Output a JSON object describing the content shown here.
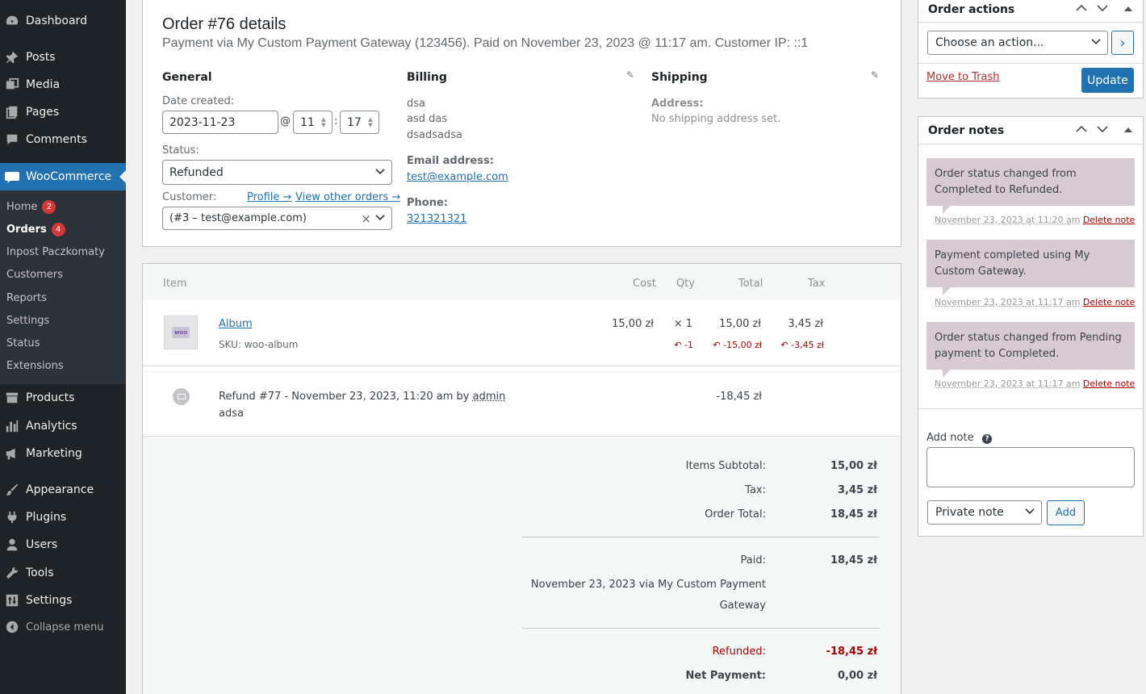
{
  "sidebar": {
    "items": [
      {
        "label": "Dashboard"
      },
      {
        "label": "Posts"
      },
      {
        "label": "Media"
      },
      {
        "label": "Pages"
      },
      {
        "label": "Comments"
      },
      {
        "label": "WooCommerce"
      },
      {
        "label": "Products"
      },
      {
        "label": "Analytics"
      },
      {
        "label": "Marketing"
      },
      {
        "label": "Appearance"
      },
      {
        "label": "Plugins"
      },
      {
        "label": "Users"
      },
      {
        "label": "Tools"
      },
      {
        "label": "Settings"
      }
    ],
    "woo_submenu": [
      {
        "label": "Home",
        "badge": "2"
      },
      {
        "label": "Orders",
        "badge": "4"
      },
      {
        "label": "Inpost Paczkomaty"
      },
      {
        "label": "Customers"
      },
      {
        "label": "Reports"
      },
      {
        "label": "Settings"
      },
      {
        "label": "Status"
      },
      {
        "label": "Extensions"
      }
    ],
    "collapse_label": "Collapse menu"
  },
  "order": {
    "title": "Order #76 details",
    "subtitle": "Payment via My Custom Payment Gateway (123456). Paid on November 23, 2023 @ 11:17 am. Customer IP: ::1",
    "general": {
      "title": "General",
      "date_label": "Date created:",
      "date_value": "2023-11-23",
      "at": "@",
      "hour": "11",
      "colon": ":",
      "minute": "17",
      "status_label": "Status:",
      "status_value": "Refunded",
      "customer_label": "Customer:",
      "profile_link": "Profile →",
      "other_orders_link": "View other orders →",
      "customer_value": "(#3 – test@example.com)",
      "clear": "×"
    },
    "billing": {
      "title": "Billing",
      "address_lines": [
        "dsa",
        "asd das",
        "dsadsadsa"
      ],
      "email_label": "Email address:",
      "email": "test@example.com",
      "phone_label": "Phone:",
      "phone": "321321321"
    },
    "shipping": {
      "title": "Shipping",
      "address_label": "Address:",
      "address_value": "No shipping address set."
    }
  },
  "items": {
    "headers": {
      "item": "Item",
      "cost": "Cost",
      "qty": "Qty",
      "total": "Total",
      "tax": "Tax"
    },
    "rows": [
      {
        "name": "Album",
        "sku": "SKU: woo-album",
        "thumb": "woo",
        "cost": "15,00 zł",
        "qty": "× 1",
        "total": "15,00 zł",
        "tax": "3,45 zł",
        "refund_qty": "↶ -1",
        "refund_total": "↶ -15,00 zł",
        "refund_tax": "↶ -3,45 zł"
      }
    ],
    "refund": {
      "text": "Refund #77 - November 23, 2023, 11:20 am by",
      "by": "admin",
      "reason": "adsa",
      "amount": "-18,45 zł"
    }
  },
  "totals": {
    "items_subtotal_label": "Items Subtotal:",
    "items_subtotal": "15,00 zł",
    "tax_label": "Tax:",
    "tax": "3,45 zł",
    "order_total_label": "Order Total:",
    "order_total": "18,45 zł",
    "paid_label": "Paid:",
    "paid": "18,45 zł",
    "paid_via_line1": "November 23, 2023 via My Custom Payment",
    "paid_via_line2": "Gateway",
    "refunded_label": "Refunded:",
    "refunded": "-18,45 zł",
    "net_label": "Net Payment:",
    "net": "0,00 zł"
  },
  "order_actions": {
    "title": "Order actions",
    "select_value": "Choose an action...",
    "go": "›",
    "trash": "Move to Trash",
    "update": "Update"
  },
  "order_notes": {
    "title": "Order notes",
    "notes": [
      {
        "text": "Order status changed from Completed to Refunded.",
        "meta": "November 23, 2023 at 11:20 am",
        "delete": "Delete note"
      },
      {
        "text": "Payment completed using My Custom Gateway.",
        "meta": "November 23, 2023 at 11:17 am",
        "delete": "Delete note"
      },
      {
        "text": "Order status changed from Pending payment to Completed.",
        "meta": "November 23, 2023 at 11:17 am",
        "delete": "Delete note"
      }
    ],
    "add_note_label": "Add note",
    "help": "?",
    "note_type": "Private note",
    "add_button": "Add"
  },
  "colors": {
    "sidebar_bg": "#1d2327",
    "accent": "#2271b1",
    "note_bg": "#d7cad2",
    "danger": "#aa0000"
  }
}
